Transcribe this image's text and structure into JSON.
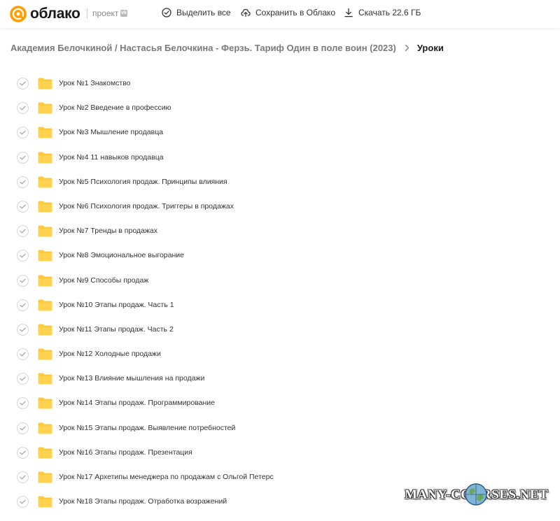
{
  "app": {
    "logo_text": "облако",
    "project_label": "проект",
    "vk_badge": "vk",
    "brand_color": "#FF9E00"
  },
  "toolbar": {
    "select_all_label": "Выделить все",
    "save_label": "Сохранить в Облако",
    "download_label": "Скачать 22.6 ГБ"
  },
  "breadcrumb": {
    "parent": "Академия Белочкиной / Настасья Белочкина - Ферзь. Тариф Один в поле воин (2023)",
    "current": "Уроки"
  },
  "files": [
    {
      "name": "Урок №1 Знакомство",
      "icon": "folder-icon"
    },
    {
      "name": "Урок №2 Введение в профессию",
      "icon": "folder-icon"
    },
    {
      "name": "Урок №3 Мышление продавца",
      "icon": "folder-icon"
    },
    {
      "name": "Урок №4 11 навыков продавца",
      "icon": "folder-icon"
    },
    {
      "name": "Урок №5 Психология продаж. Принципы влияния",
      "icon": "folder-icon"
    },
    {
      "name": "Урок №6 Психология продаж. Триггеры в продажах",
      "icon": "folder-icon"
    },
    {
      "name": "Урок №7 Тренды в продажах",
      "icon": "folder-icon"
    },
    {
      "name": "Урок №8 Эмоциональное выгорание",
      "icon": "folder-icon"
    },
    {
      "name": "Урок №9 Способы продаж",
      "icon": "folder-icon"
    },
    {
      "name": "Урок №10 Этапы продаж. Часть 1",
      "icon": "folder-icon"
    },
    {
      "name": "Урок №11 Этапы продаж. Часть 2",
      "icon": "folder-icon"
    },
    {
      "name": "Урок №12 Холодные продажи",
      "icon": "folder-icon"
    },
    {
      "name": "Урок №13 Влияние мышления на продажи",
      "icon": "folder-icon"
    },
    {
      "name": "Урок №14 Этапы продаж. Программирование",
      "icon": "folder-icon"
    },
    {
      "name": "Урок №15 Этапы продаж. Выявление потребностей",
      "icon": "folder-icon"
    },
    {
      "name": "Урок №16 Этапы продаж. Презентация",
      "icon": "folder-icon"
    },
    {
      "name": "Урок №17 Архетипы менеджера по продажам с Ольгой Петерс",
      "icon": "folder-icon"
    },
    {
      "name": "Урок №18 Этапы продаж. Отработка возражений",
      "icon": "folder-icon"
    }
  ],
  "watermark": {
    "text": "MANY-COURSES.NET"
  }
}
